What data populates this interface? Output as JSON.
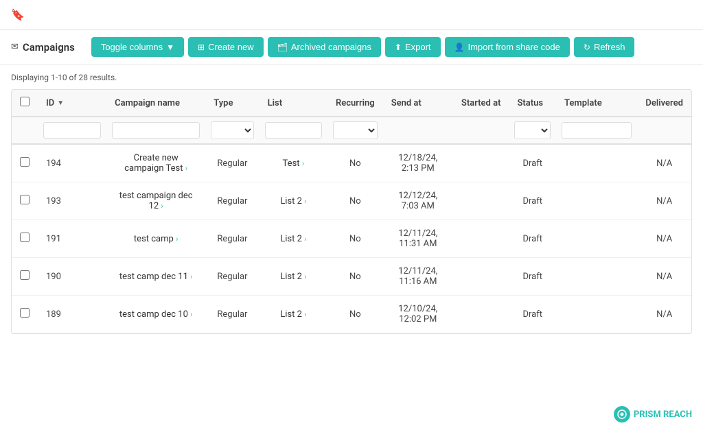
{
  "topbar": {
    "bookmark_icon": "🔖"
  },
  "header": {
    "envelope_icon": "✉",
    "page_title": "Campaigns",
    "buttons": {
      "toggle_columns": "Toggle columns",
      "create_new": "Create new",
      "archived_campaigns": "Archived campaigns",
      "export": "Export",
      "import_share_code": "Import from share code",
      "refresh": "Refresh"
    }
  },
  "results_info": "Displaying 1-10 of 28 results.",
  "table": {
    "columns": [
      "",
      "ID",
      "Campaign name",
      "Type",
      "List",
      "Recurring",
      "Send at",
      "Started at",
      "Status",
      "Template",
      "Delivered"
    ],
    "rows": [
      {
        "id": "194",
        "name": "Create new campaign Test",
        "type": "Regular",
        "list": "Test",
        "recurring": "No",
        "send_at": "12/18/24, 2:13 PM",
        "started_at": "",
        "status": "Draft",
        "template": "",
        "delivered": "N/A"
      },
      {
        "id": "193",
        "name": "test campaign dec 12",
        "type": "Regular",
        "list": "List 2",
        "recurring": "No",
        "send_at": "12/12/24, 7:03 AM",
        "started_at": "",
        "status": "Draft",
        "template": "",
        "delivered": "N/A"
      },
      {
        "id": "191",
        "name": "test camp",
        "type": "Regular",
        "list": "List 2",
        "recurring": "No",
        "send_at": "12/11/24, 11:31 AM",
        "started_at": "",
        "status": "Draft",
        "template": "",
        "delivered": "N/A"
      },
      {
        "id": "190",
        "name": "test camp dec 11",
        "type": "Regular",
        "list": "List 2",
        "recurring": "No",
        "send_at": "12/11/24, 11:16 AM",
        "started_at": "",
        "status": "Draft",
        "template": "",
        "delivered": "N/A"
      },
      {
        "id": "189",
        "name": "test camp dec 10",
        "type": "Regular",
        "list": "List 2",
        "recurring": "No",
        "send_at": "12/10/24, 12:02 PM",
        "started_at": "",
        "status": "Draft",
        "template": "",
        "delivered": "N/A"
      }
    ]
  },
  "footer": {
    "brand_name": "PRISM REACH",
    "brand_icon": "P"
  },
  "colors": {
    "teal": "#2bbfb3",
    "teal_dark": "#26a99e"
  }
}
